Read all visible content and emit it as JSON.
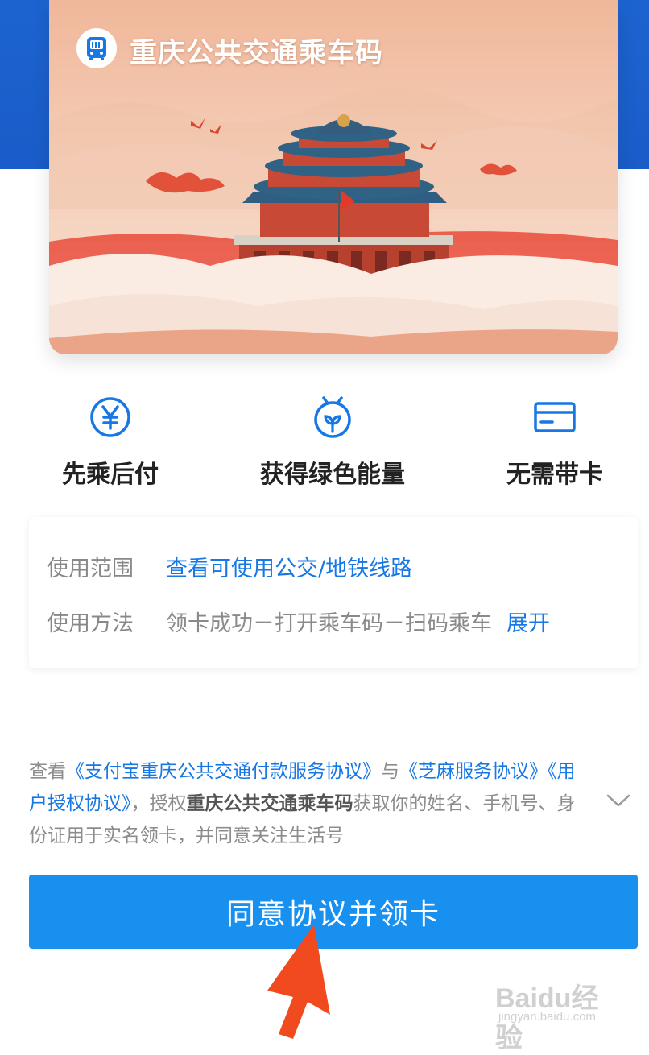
{
  "card": {
    "title": "重庆公共交通乘车码",
    "logo_icon": "bus-icon",
    "illustration": "hall-illustration"
  },
  "features": [
    {
      "label": "先乘后付",
      "icon": "yuan-circle-icon"
    },
    {
      "label": "获得绿色能量",
      "icon": "sprout-icon"
    },
    {
      "label": "无需带卡",
      "icon": "card-icon"
    }
  ],
  "info": {
    "scope_key": "使用范围",
    "scope_link": "查看可使用公交/地铁线路",
    "method_key": "使用方法",
    "method_text": "领卡成功－打开乘车码－扫码乘车",
    "method_expand": "展开"
  },
  "agreement": {
    "prefix": "查看",
    "link1": "《支付宝重庆公共交通付款服务协议》",
    "and": "与",
    "link2": "《芝麻服务协议》",
    "link3": "《用户授权协议》",
    "mid": "，授权",
    "app_name": "重庆公共交通乘车码",
    "suffix": "获取你的姓名、手机号、身份证用于实名领卡，并同意关注生活号"
  },
  "button": {
    "label": "同意协议并领卡"
  },
  "watermark": {
    "main": "Baidu经验",
    "sub": "jingyan.baidu.com"
  },
  "colors": {
    "blue_header": "#1d63d0",
    "primary": "#1890f0",
    "link": "#1677e5",
    "annotation_arrow": "#f04a1e"
  }
}
